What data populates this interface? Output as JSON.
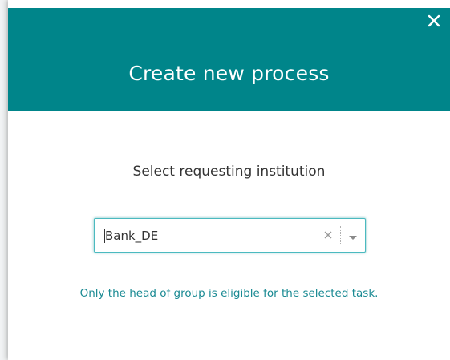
{
  "dialog": {
    "title": "Create new process",
    "close_icon": "close-icon",
    "prompt": "Select requesting institution",
    "institution_select": {
      "value": "Bank_DE",
      "clear_icon": "clear-icon",
      "dropdown_icon": "chevron-down-icon"
    },
    "notice": "Only the head of group is eligible for the selected task."
  },
  "colors": {
    "header": "#00858a",
    "accent": "#4bbac0",
    "notice_text": "#1a8a93"
  }
}
